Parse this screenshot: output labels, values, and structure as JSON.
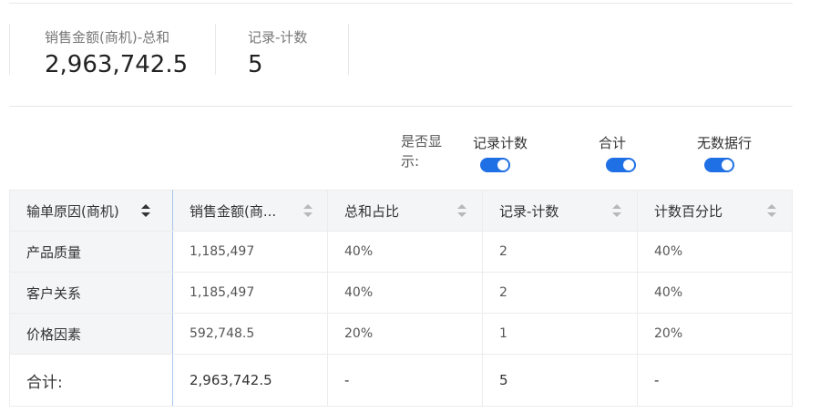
{
  "kpis": [
    {
      "label": "销售金额(商机)-总和",
      "value": "2,963,742.5"
    },
    {
      "label": "记录-计数",
      "value": "5"
    }
  ],
  "toggles": {
    "show_label": "是否显示:",
    "items": [
      {
        "label": "记录计数",
        "on": true
      },
      {
        "label": "合计",
        "on": true
      },
      {
        "label": "无数据行",
        "on": true
      }
    ]
  },
  "table": {
    "columns": [
      "输单原因(商机)",
      "销售金额(商...",
      "总和占比",
      "记录-计数",
      "计数百分比"
    ],
    "rows": [
      [
        "产品质量",
        "1,185,497",
        "40%",
        "2",
        "40%"
      ],
      [
        "客户关系",
        "1,185,497",
        "40%",
        "2",
        "40%"
      ],
      [
        "价格因素",
        "592,748.5",
        "20%",
        "1",
        "20%"
      ]
    ],
    "total": [
      "合计:",
      "2,963,742.5",
      "-",
      "5",
      "-"
    ]
  },
  "colors": {
    "accent": "#1f6fe5",
    "link": "#2d7be5"
  }
}
